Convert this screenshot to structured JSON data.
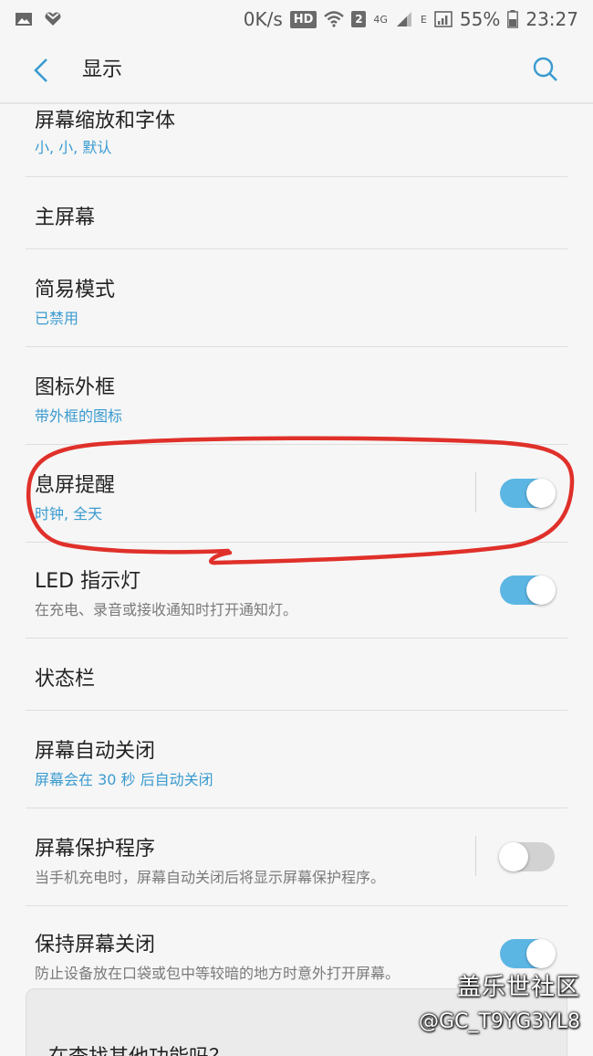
{
  "status_bar": {
    "speed": "0K/s",
    "hd": "HD",
    "sim": "2",
    "net_4g": "4G",
    "net_e": "E",
    "battery": "55%",
    "time": "23:27",
    "icons": [
      "image-icon",
      "heart-icon",
      "wifi-icon",
      "signal-icon",
      "battery-icon"
    ]
  },
  "header": {
    "title": "显示",
    "back_icon": "chevron-left-icon",
    "search_icon": "search-icon",
    "accent": "#3a9bd0"
  },
  "items": [
    {
      "title": "屏幕缩放和字体",
      "subtitle": "小, 小, 默认"
    },
    {
      "title": "主屏幕"
    },
    {
      "title": "简易模式",
      "subtitle": "已禁用"
    },
    {
      "title": "图标外框",
      "subtitle": "带外框的图标"
    },
    {
      "title": "息屏提醒",
      "subtitle": "时钟, 全天",
      "toggle": true
    },
    {
      "title": "LED 指示灯",
      "subtitle": "在充电、录音或接收通知时打开通知灯。",
      "toggle": true
    },
    {
      "title": "状态栏"
    },
    {
      "title": "屏幕自动关闭",
      "subtitle": "屏幕会在 30 秒 后自动关闭"
    },
    {
      "title": "屏幕保护程序",
      "subtitle": "当手机充电时，屏幕自动关闭后将显示屏幕保护程序。",
      "toggle": false
    },
    {
      "title": "保持屏幕关闭",
      "subtitle": "防止设备放在口袋或包中等较暗的地方时意外打开屏幕。",
      "toggle": true
    }
  ],
  "card": {
    "title": "在查找其他功能吗？"
  },
  "watermark": {
    "line1": "盖乐世社区",
    "line2": "@GC_T9YG3YL8"
  },
  "colors": {
    "toggle_on": "#5cb6e4",
    "toggle_off": "#d2d2d2",
    "annotation": "#e0302a"
  }
}
